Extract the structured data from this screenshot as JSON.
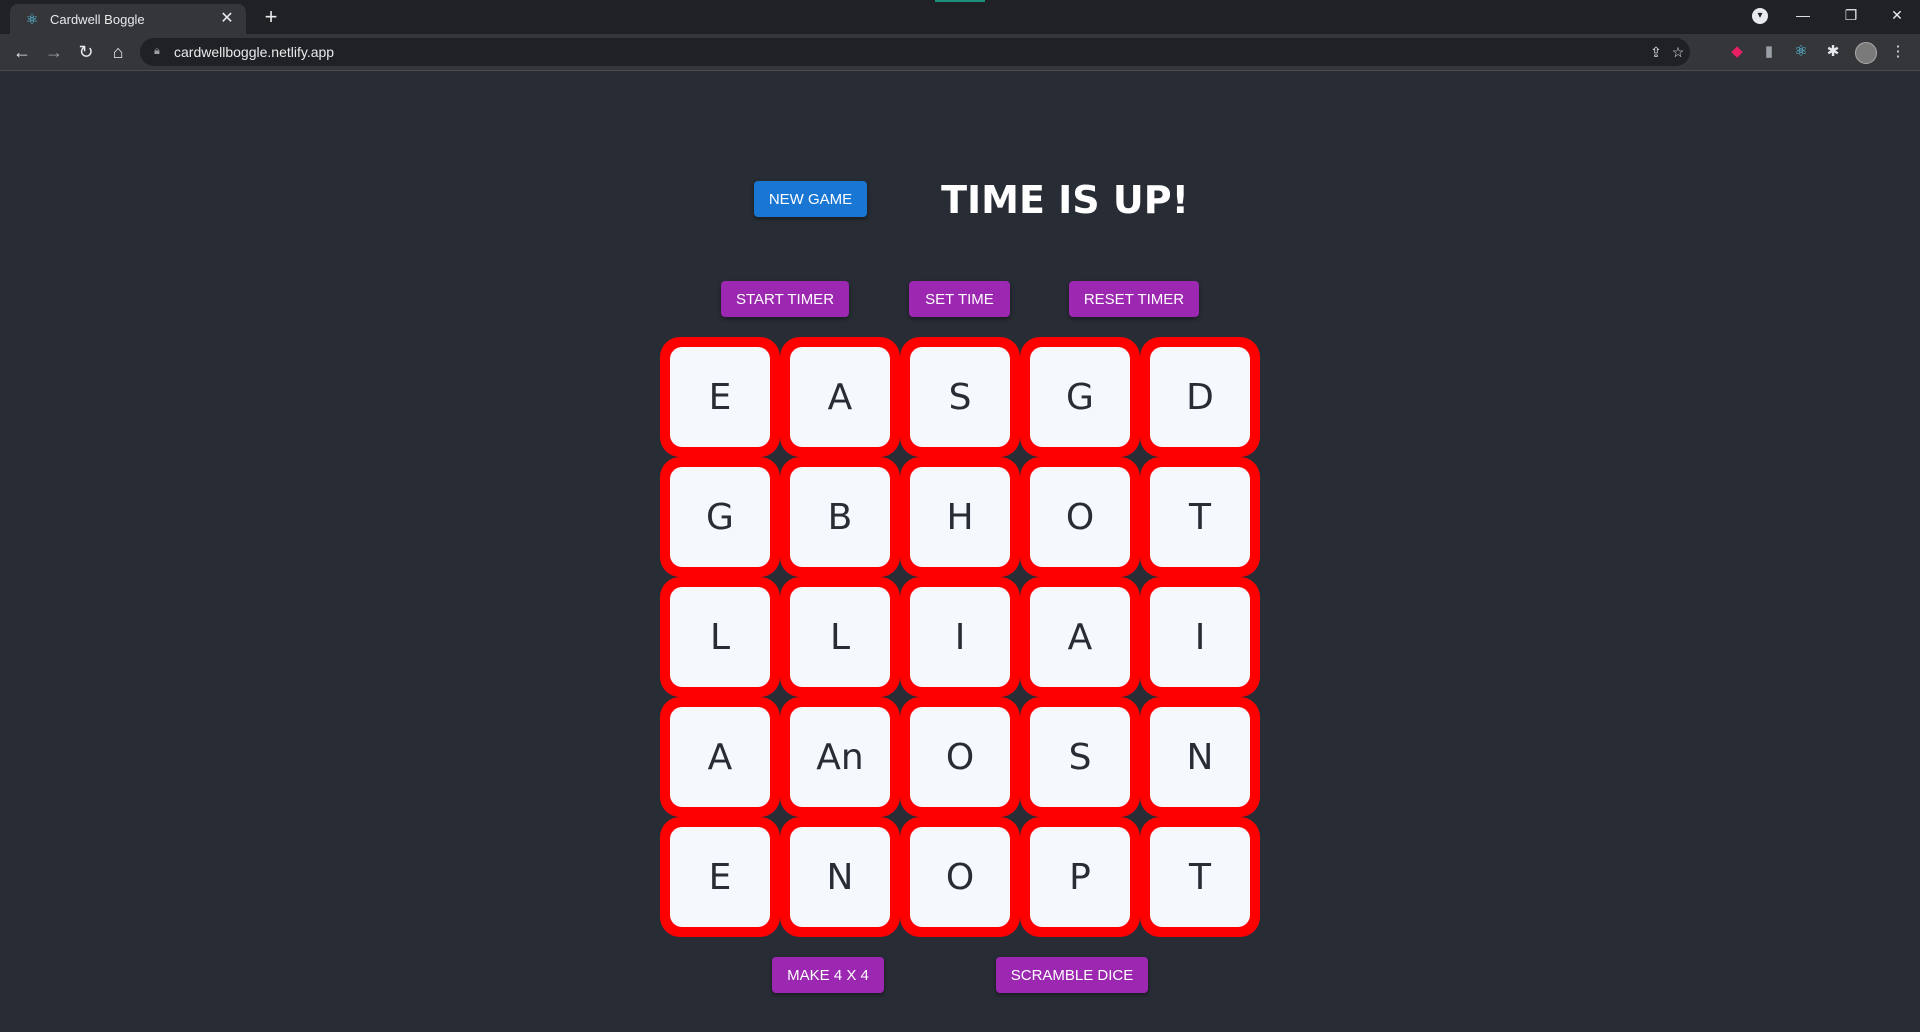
{
  "browser": {
    "tab_title": "Cardwell Boggle",
    "url": "cardwellboggle.netlify.app"
  },
  "game": {
    "new_game_label": "NEW GAME",
    "status_text": "TIME IS UP!",
    "start_timer_label": "START TIMER",
    "set_time_label": "SET TIME",
    "reset_timer_label": "RESET TIMER",
    "make_4x4_label": "MAKE 4 X 4",
    "scramble_label": "SCRAMBLE DICE",
    "board": [
      [
        "E",
        "A",
        "S",
        "G",
        "D"
      ],
      [
        "G",
        "B",
        "H",
        "O",
        "T"
      ],
      [
        "L",
        "L",
        "I",
        "A",
        "I"
      ],
      [
        "A",
        "An",
        "O",
        "S",
        "N"
      ],
      [
        "E",
        "N",
        "O",
        "P",
        "T"
      ]
    ]
  },
  "colors": {
    "background": "#282c34",
    "die_border": "#ff0000",
    "primary_button": "#1976d2",
    "secondary_button": "#9c27b0"
  }
}
